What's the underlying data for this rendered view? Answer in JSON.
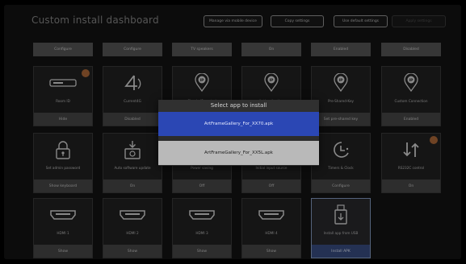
{
  "header": {
    "title": "Custom install dashboard",
    "buttons": [
      {
        "label": "Manage via mobile device",
        "enabled": true
      },
      {
        "label": "Copy settings",
        "enabled": true
      },
      {
        "label": "Use default settings",
        "enabled": true
      },
      {
        "label": "Apply settings",
        "enabled": false
      }
    ]
  },
  "top_bar": [
    "Configure",
    "Configure",
    "TV speakers",
    "On",
    "Enabled",
    "Disabled"
  ],
  "row1": [
    {
      "icon": "set-top-box-icon",
      "name": "Room ID",
      "button": "Hide",
      "badge": true
    },
    {
      "icon": "4g-icon",
      "name": "Current4G",
      "button": "Disabled"
    },
    {
      "icon": "ip-pin-icon",
      "name": "Simple IP control",
      "button": "Disabled"
    },
    {
      "icon": "ip-pin-icon",
      "name": "Authentication",
      "button": "Enabled"
    },
    {
      "icon": "ip-pin-icon",
      "name": "Pre-Shared-Key",
      "button": "Set pre-shared key"
    },
    {
      "icon": "ip-pin-icon",
      "name": "Custom Connection",
      "button": "Enabled"
    }
  ],
  "row2": [
    {
      "icon": "lock-icon",
      "name": "Set admin password",
      "button": "Show keyboard"
    },
    {
      "icon": "software-update-icon",
      "name": "Auto software update",
      "button": "On"
    },
    {
      "icon": "power-icon",
      "name": "Power saving",
      "button": "Off"
    },
    {
      "icon": "input-source-icon",
      "name": "Initial input source",
      "button": "Off"
    },
    {
      "icon": "timer-clock-icon",
      "name": "Timers & Clock",
      "button": "Configure"
    },
    {
      "icon": "rs232-arrows-icon",
      "name": "RS232C control",
      "button": "On",
      "badge": true
    }
  ],
  "row3": [
    {
      "icon": "hdmi-icon",
      "name": "HDMI 1",
      "button": "Show"
    },
    {
      "icon": "hdmi-icon",
      "name": "HDMI 2",
      "button": "Show"
    },
    {
      "icon": "hdmi-icon",
      "name": "HDMI 3",
      "button": "Show"
    },
    {
      "icon": "hdmi-icon",
      "name": "HDMI 4",
      "button": "Show"
    },
    {
      "icon": "usb-install-icon",
      "name": "Install app from USB",
      "button": "Install APK",
      "selected": true
    }
  ],
  "dialog": {
    "title": "Select app to install",
    "options": [
      "ArtFrameGallery_For_XX70.apk",
      "ArtFrameGallery_For_XX5L.apk"
    ],
    "selected_index": 0
  },
  "colors": {
    "accent_blue": "#2b47b4",
    "badge_orange": "#b46d3a"
  }
}
